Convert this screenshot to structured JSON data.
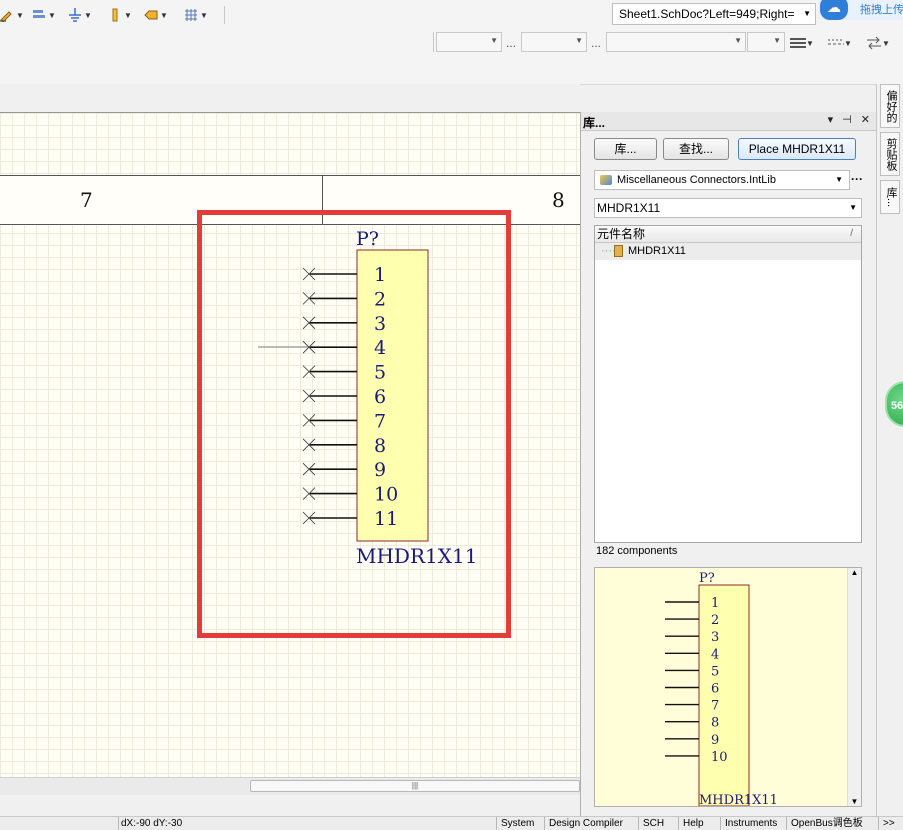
{
  "toolbar": {
    "items": [
      {
        "icon": "wire-pencil-icon"
      },
      {
        "icon": "bus-icon"
      },
      {
        "icon": "ground-icon"
      },
      {
        "icon": "power-port-icon"
      },
      {
        "icon": "port-icon"
      },
      {
        "icon": "grid-icon"
      }
    ],
    "document_address": "Sheet1.SchDoc?Left=949;Right=",
    "cloud_upload_label": "拖拽上传"
  },
  "schematic": {
    "zone_labels": [
      "7",
      "8"
    ],
    "part": {
      "designator": "P?",
      "comment": "MHDR1X11",
      "pins": [
        "1",
        "2",
        "3",
        "4",
        "5",
        "6",
        "7",
        "8",
        "9",
        "10",
        "11"
      ]
    },
    "highlight_color": "#e43b3b"
  },
  "library_panel": {
    "title": "库...",
    "header_controls": "▾ ⊣ ✕",
    "buttons": {
      "libraries": "库...",
      "search": "查找...",
      "place": "Place MHDR1X11"
    },
    "selected_library": "Miscellaneous Connectors.IntLib",
    "more": "···",
    "filter": "MHDR1X11",
    "column_header": "元件名称",
    "column_sort": "/",
    "components": [
      {
        "name": "MHDR1X11"
      }
    ],
    "count": "182 components",
    "preview": {
      "designator": "P?",
      "comment": "MHDR1X11",
      "pins": [
        "1",
        "2",
        "3",
        "4",
        "5",
        "6",
        "7",
        "8",
        "9",
        "10"
      ]
    }
  },
  "dock_tabs": [
    "偏好的",
    "剪贴板",
    "库..."
  ],
  "badge": "56",
  "status_bar": {
    "coordinates": "dX:-90 dY:-30",
    "tabs": [
      "System",
      "Design Compiler",
      "SCH",
      "Help",
      "Instruments",
      "OpenBus调色板",
      ">>"
    ]
  }
}
